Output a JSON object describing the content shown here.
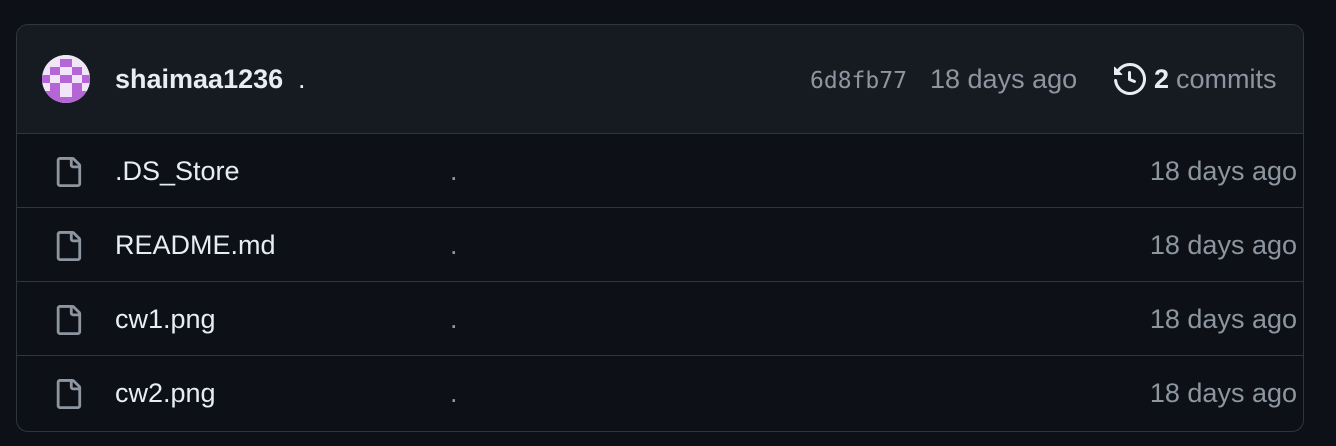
{
  "commit": {
    "author": "shaimaa1236",
    "message": ".",
    "sha": "6d8fb77",
    "time": "18 days ago",
    "commits_count": "2",
    "commits_label": "commits"
  },
  "files": [
    {
      "name": ".DS_Store",
      "message": ".",
      "time": "18 days ago"
    },
    {
      "name": "README.md",
      "message": ".",
      "time": "18 days ago"
    },
    {
      "name": "cw1.png",
      "message": ".",
      "time": "18 days ago"
    },
    {
      "name": "cw2.png",
      "message": ".",
      "time": "18 days ago"
    }
  ],
  "icons": {
    "avatar": "identicon-avatar",
    "history": "history-icon",
    "file": "file-icon"
  },
  "colors": {
    "background": "#0d1117",
    "header": "#161b22",
    "border": "#30363d",
    "text": "#e6edf3",
    "muted": "#8d96a0",
    "avatar_accent": "#b565d6"
  }
}
